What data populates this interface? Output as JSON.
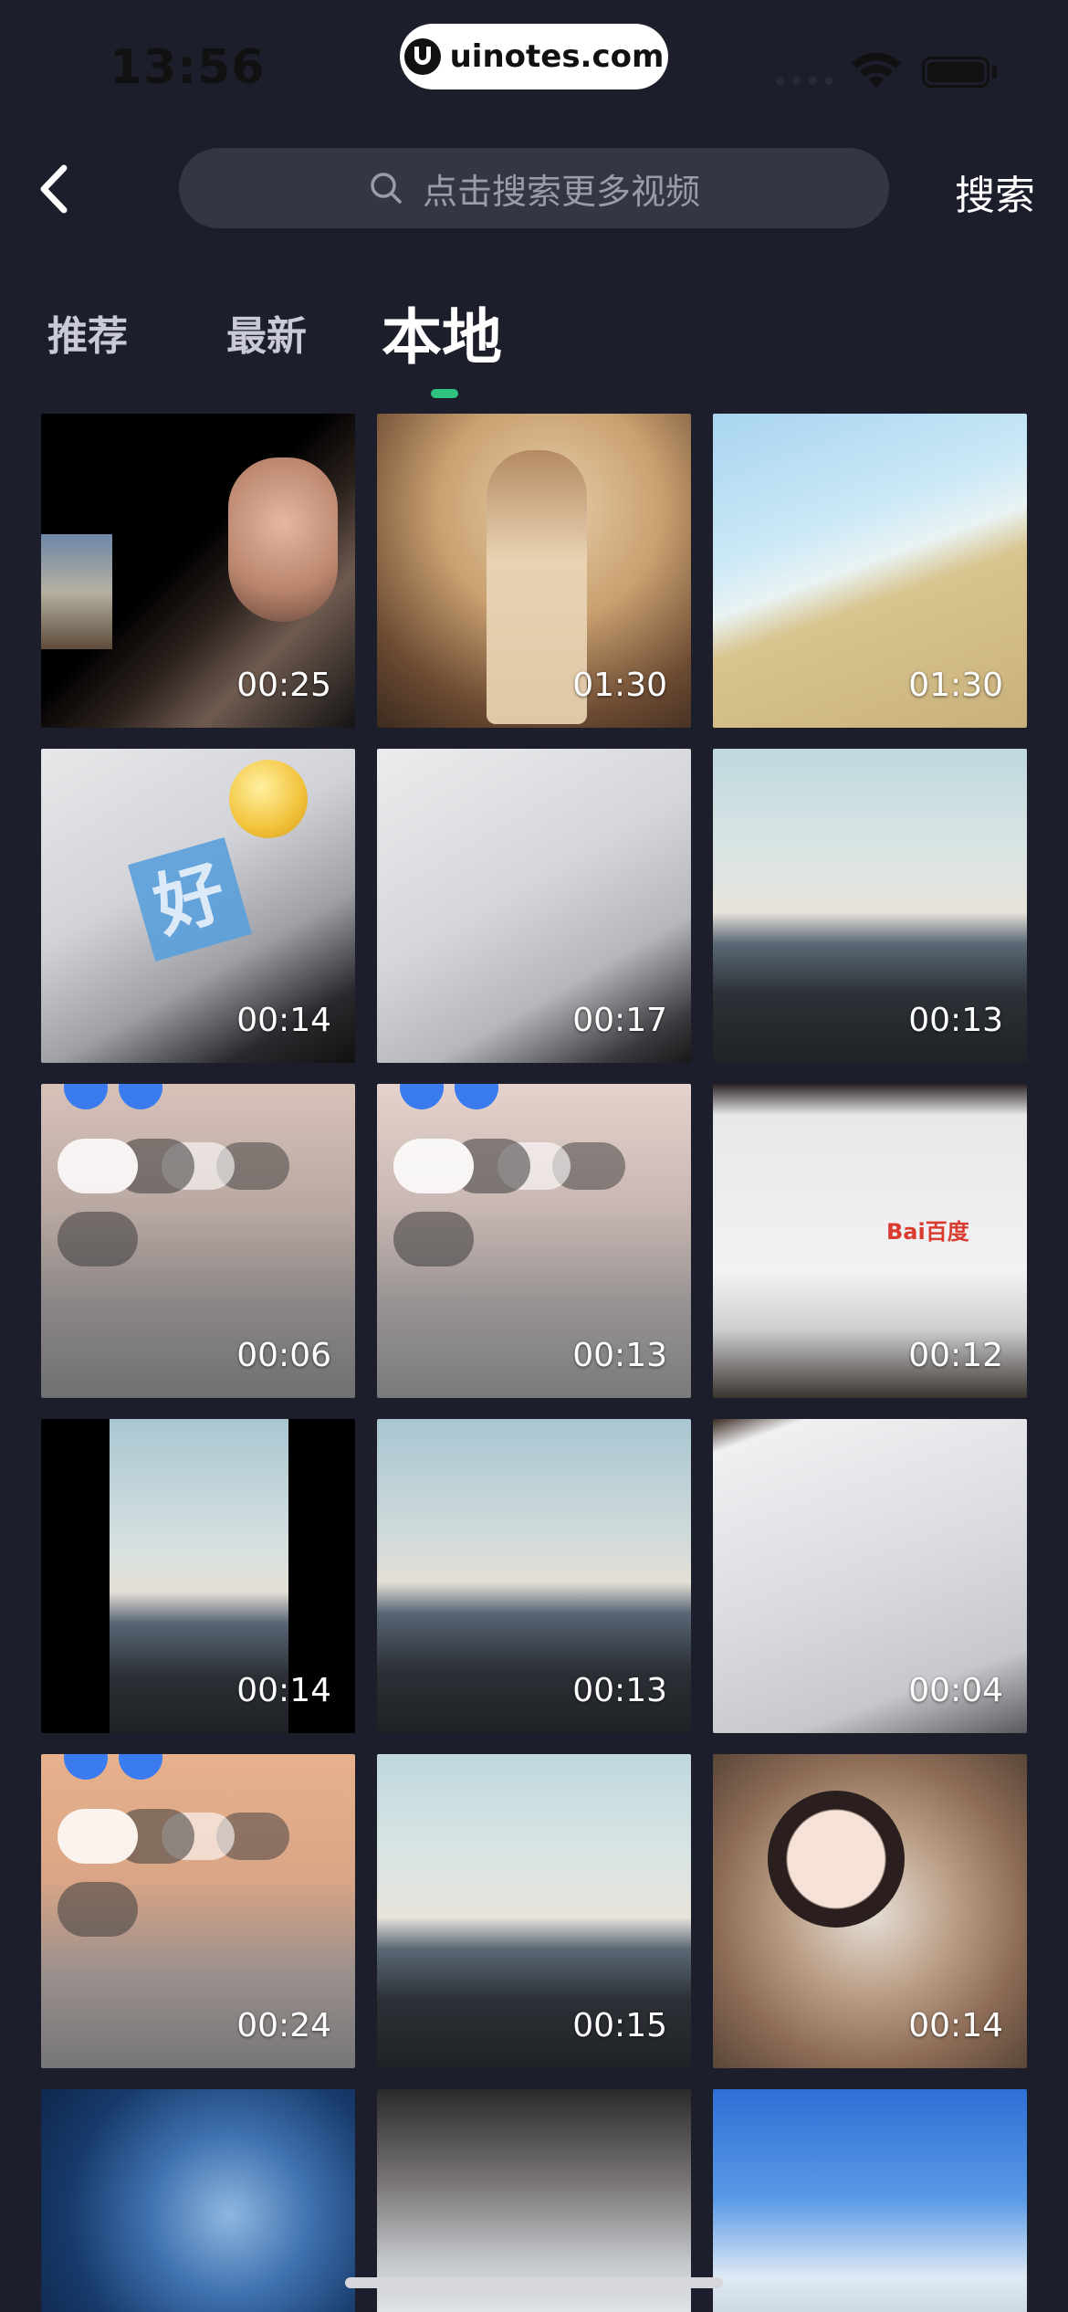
{
  "status_bar": {
    "time": "13:56",
    "watermark": "uinotes.com"
  },
  "header": {
    "search_placeholder": "点击搜索更多视频",
    "search_button": "搜索"
  },
  "tabs": [
    {
      "label": "推荐"
    },
    {
      "label": "最新"
    },
    {
      "label": "本地",
      "active": true
    }
  ],
  "colors": {
    "background": "#1d1e2c",
    "search_box": "#343646",
    "tab_indicator": "#2ec27e"
  },
  "videos": [
    {
      "thumb": "man-portrait",
      "duration": "00:25"
    },
    {
      "thumb": "anime-girl",
      "duration": "01:30"
    },
    {
      "thumb": "beach-waves",
      "duration": "01:30"
    },
    {
      "thumb": "keyboard-emoji",
      "duration": "00:14"
    },
    {
      "thumb": "keyboard",
      "duration": "00:17"
    },
    {
      "thumb": "road-sunset",
      "duration": "00:13"
    },
    {
      "thumb": "control-center",
      "duration": "00:06"
    },
    {
      "thumb": "control-center",
      "duration": "00:13"
    },
    {
      "thumb": "baidu-screen",
      "duration": "00:12"
    },
    {
      "thumb": "road-narrow",
      "duration": "00:14"
    },
    {
      "thumb": "road-sunset",
      "duration": "00:13"
    },
    {
      "thumb": "keyboard",
      "duration": "00:04"
    },
    {
      "thumb": "control-center",
      "duration": "00:24"
    },
    {
      "thumb": "road-sunset",
      "duration": "00:15"
    },
    {
      "thumb": "anime-girl",
      "duration": "00:14"
    },
    {
      "thumb": "galaxy",
      "duration": ""
    },
    {
      "thumb": "desk-keyboard",
      "duration": ""
    },
    {
      "thumb": "sky-clouds",
      "duration": ""
    }
  ]
}
